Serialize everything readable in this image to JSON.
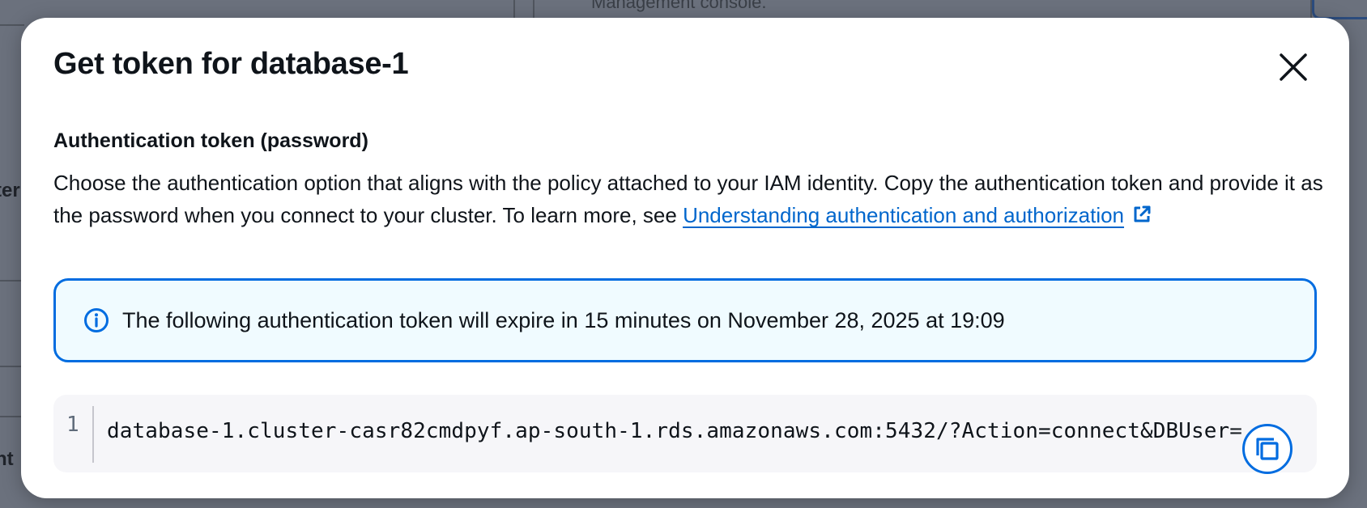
{
  "background": {
    "left_fragment_1": "ter",
    "left_fragment_2": "nt",
    "top_fragment": "Management console."
  },
  "modal": {
    "title": "Get token for database-1",
    "close_icon": "close-icon",
    "section_label": "Authentication token (password)",
    "description_text": "Choose the authentication option that aligns with the policy attached to your IAM identity. Copy the authentication token and provide it as the password when you connect to your cluster. To learn more, see ",
    "link_text": "Understanding authentication and authorization",
    "link_icon": "external-link-icon"
  },
  "alert": {
    "icon": "info-icon",
    "text": "The following authentication token will expire in 15 minutes on November 28, 2025 at 19:09"
  },
  "code": {
    "line_number": "1",
    "token": "database-1.cluster-casr82cmdpyf.ap-south-1.rds.amazonaws.com:5432/?Action=connect&DBUser=",
    "copy_icon": "copy-icon"
  },
  "colors": {
    "accent": "#006ce0",
    "link": "#0066cc",
    "alert_bg": "#f0fbff",
    "overlay": "#6b717d"
  }
}
